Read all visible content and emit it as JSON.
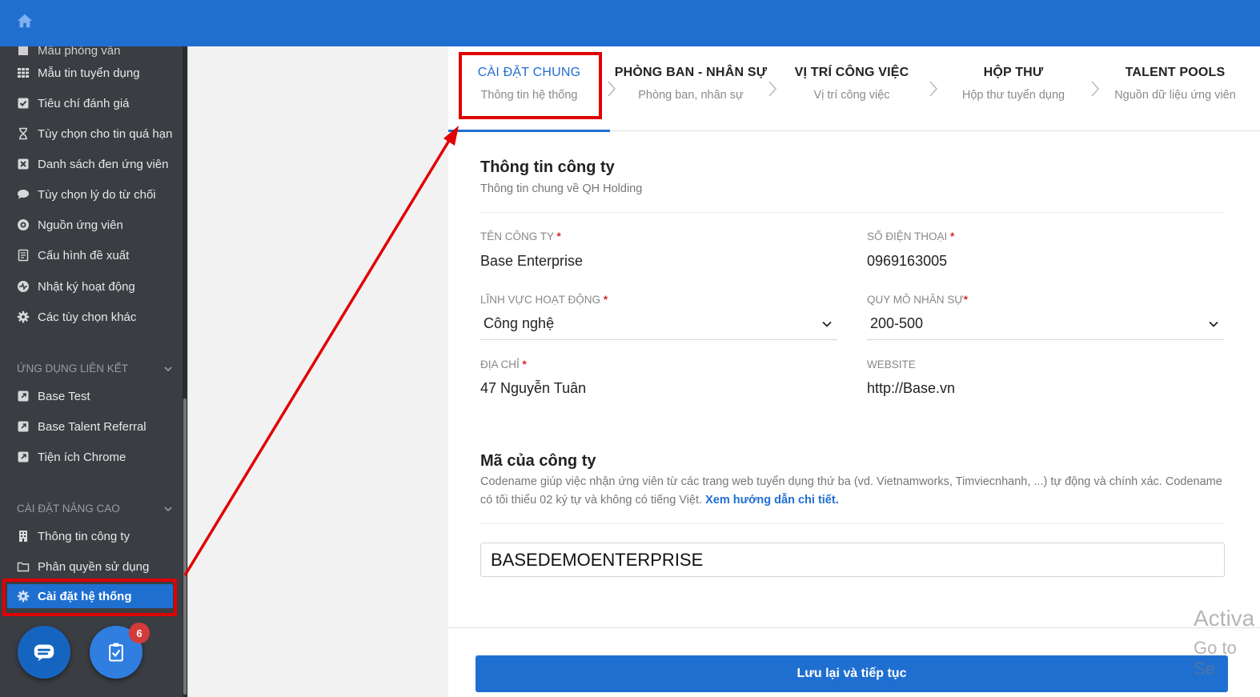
{
  "topbar": {
    "home_icon": "home-icon"
  },
  "sidebar": {
    "partial_item": "Mẫu phỏng vấn",
    "items": [
      {
        "label": "Mẫu tin tuyển dụng",
        "icon": "grid-icon"
      },
      {
        "label": "Tiêu chí đánh giá",
        "icon": "checkbox-icon"
      },
      {
        "label": "Tùy chọn cho tin quá hạn",
        "icon": "hourglass-icon"
      },
      {
        "label": "Danh sách đen ứng viên",
        "icon": "blacklist-icon"
      },
      {
        "label": "Tùy chọn lý do từ chối",
        "icon": "comment-icon"
      },
      {
        "label": "Nguồn ứng viên",
        "icon": "source-icon"
      },
      {
        "label": "Cấu hình đề xuất",
        "icon": "document-icon"
      },
      {
        "label": "Nhật ký hoạt động",
        "icon": "activity-icon"
      },
      {
        "label": "Các tùy chọn khác",
        "icon": "gear-icon"
      }
    ],
    "linked_apps_section": "ỨNG DỤNG LIÊN KẾT",
    "linked_apps": [
      {
        "label": "Base Test",
        "icon": "external-link-icon"
      },
      {
        "label": "Base Talent Referral",
        "icon": "external-link-icon"
      },
      {
        "label": "Tiện ích Chrome",
        "icon": "external-link-icon"
      }
    ],
    "advanced_section": "CÀI ĐẶT NÂNG CAO",
    "advanced_items": [
      {
        "label": "Thông tin công ty",
        "icon": "building-icon"
      },
      {
        "label": "Phân quyền sử dụng",
        "icon": "folder-icon"
      },
      {
        "label": "Cài đặt hệ thống",
        "icon": "gear-icon"
      }
    ],
    "task_badge": "6"
  },
  "steps": [
    {
      "title": "CÀI ĐẶT CHUNG",
      "subtitle": "Thông tin hệ thống"
    },
    {
      "title": "PHÒNG BAN - NHÂN SỰ",
      "subtitle": "Phòng ban, nhân sự"
    },
    {
      "title": "VỊ TRÍ CÔNG VIỆC",
      "subtitle": "Vị trí công việc"
    },
    {
      "title": "HỘP THƯ",
      "subtitle": "Hộp thư tuyển dụng"
    },
    {
      "title": "TALENT POOLS",
      "subtitle": "Nguồn dữ liệu ứng viên"
    }
  ],
  "company_info": {
    "title": "Thông tin công ty",
    "subtitle": "Thông tin chung về QH Holding",
    "required_mark": "*",
    "name_label": "TÊN CÔNG TY",
    "name_value": "Base Enterprise",
    "phone_label": "SỐ ĐIỆN THOẠI",
    "phone_value": "0969163005",
    "industry_label": "LĨNH VỰC HOẠT ĐỘNG",
    "industry_value": "Công nghệ",
    "size_label": "QUY MÔ NHÂN SỰ",
    "size_value": "200-500",
    "address_label": "ĐỊA CHỈ",
    "address_value": "47 Nguyễn Tuân",
    "website_label": "WEBSITE",
    "website_value": "http://Base.vn"
  },
  "company_code": {
    "title": "Mã của công ty",
    "description": "Codename giúp việc nhận ứng viên từ các trang web tuyển dụng thứ ba (vd. Vietnamworks, Timviecnhanh, ...) tự động và chính xác. Codename có tối thiểu 02 ký tự và không có tiếng Việt.",
    "guide_link": "Xem hướng dẫn chi tiết.",
    "value": "BASEDEMOENTERPRISE"
  },
  "save_button": "Lưu lại và tiếp tục",
  "watermark": {
    "line1": "Activa",
    "line2": "Go to Se"
  },
  "colors": {
    "primary": "#1f6fd1",
    "sidebar_bg": "#3a3d42",
    "annotation_red": "#e00000",
    "badge_red": "#d43a3a"
  }
}
